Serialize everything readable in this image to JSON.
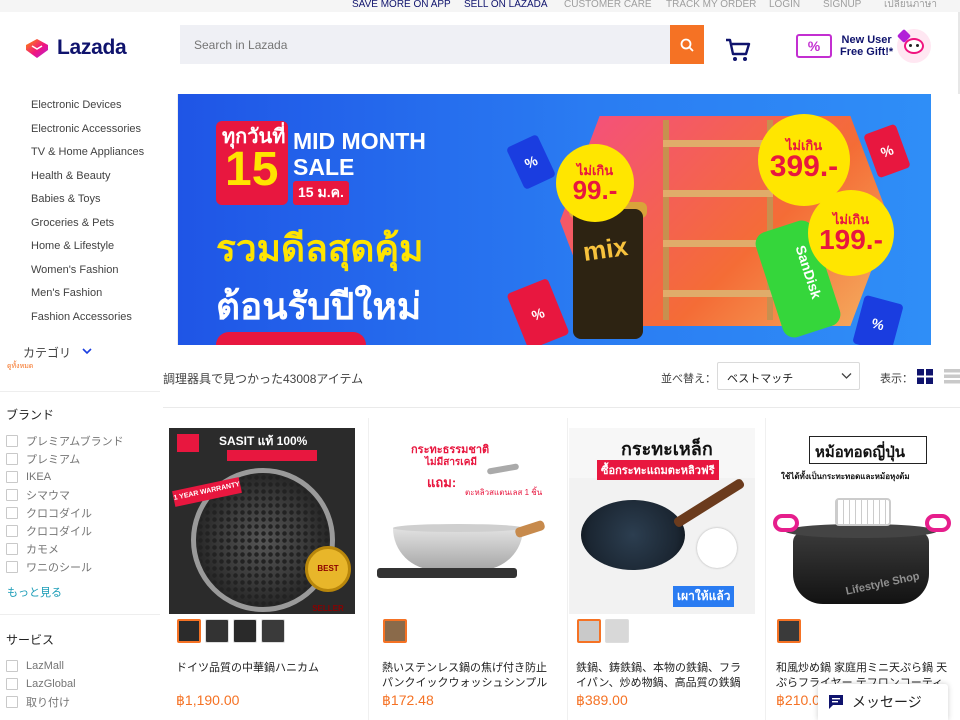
{
  "top_links": [
    "SAVE MORE ON APP",
    "SELL ON LAZADA",
    "CUSTOMER CARE",
    "TRACK MY ORDER",
    "LOGIN",
    "SIGNUP",
    "เปลี่ยนภาษา"
  ],
  "header": {
    "logo_text": "Lazada",
    "search_placeholder": "Search in Lazada",
    "promo_line1": "New User",
    "promo_line2": "Free Gift!*",
    "promo_ticket": "%"
  },
  "categories": [
    "Electronic Devices",
    "Electronic Accessories",
    "TV & Home Appliances",
    "Health & Beauty",
    "Babies & Toys",
    "Groceries & Pets",
    "Home & Lifestyle",
    "Women's Fashion",
    "Men's Fashion",
    "Fashion Accessories"
  ],
  "banner": {
    "thai_top": "ทุกวันที่",
    "day": "15",
    "headline1": "MID MONTH",
    "headline2": "SALE",
    "date": "15 ม.ค.",
    "thai_line1": "รวมดีลสุดคุ้ม",
    "thai_line2": "ต้อนรับปีใหม่",
    "prices": [
      {
        "top": "ไม่เกิน",
        "value": "99.-"
      },
      {
        "top": "ไม่เกิน",
        "value": "399.-"
      },
      {
        "top": "ไม่เกิน",
        "value": "199.-"
      }
    ],
    "product_text_1": "mix",
    "product_text_2": "SanDisk"
  },
  "category_dropdown": {
    "label": "カテゴリ",
    "sub": "ดูทั้งหมด"
  },
  "results": {
    "title": "調理器具で見つかった43008アイテム",
    "sort_label": "並べ替え：",
    "sort_value": "ベストマッチ",
    "view_label": "表示："
  },
  "filters": {
    "brand_heading": "ブランド",
    "brands": [
      "プレミアムブランド",
      "プレミアム",
      "IKEA",
      "シマウマ",
      "クロコダイル",
      "クロコダイル",
      "カモメ",
      "ワニのシール"
    ],
    "more_label": "もっと見る",
    "service_heading": "サービス",
    "services": [
      "LazMall",
      "LazGlobal",
      "取り付け"
    ]
  },
  "products": [
    {
      "title": "ドイツ品質の中華鍋ハニカム",
      "price": "฿1,190.00",
      "img_text_1": "SASIT แท้ 100%",
      "img_text_2": "1 YEAR WARRANTY",
      "img_text_3": "BEST SELLER",
      "thumb_count": 4
    },
    {
      "title": "熱いステンレス鍋の焦げ付き防止パンクイックウォッシュシンプルな揚...",
      "price": "฿172.48",
      "img_text_1": "กระทะธรรมชาติ",
      "img_text_2": "ไม่มีสารเคมี",
      "img_text_3": "แถม:",
      "img_text_4": "ตะหลิวสแตนเลส 1 ชิ้น",
      "thumb_count": 1
    },
    {
      "title": "鉄鍋、鋳鉄鍋、本物の鉄鍋、フライパン、炒め物鍋、高品質の鉄鍋 フ...",
      "price": "฿389.00",
      "img_text_1": "กระทะเหล็ก",
      "img_text_2": "ซื้อกระทะแถมตะหลิวฟรี",
      "img_text_3": "เผาให้แล้ว",
      "thumb_count": 2
    },
    {
      "title": "和風炒め鍋 家庭用ミニ天ぷら鍋 天ぷらフライヤー テフロンコーティン...",
      "price": "฿210.0",
      "img_text_1": "หม้อทอดญี่ปุ่น",
      "img_text_2": "ใช้ได้ทั้งเป็นกระทะทอดและหม้อหุงต้ม",
      "img_text_3": "Lifestyle Shop",
      "thumb_count": 1
    }
  ],
  "chat": {
    "label": "メッセージ"
  },
  "colors": {
    "accent": "#f57224",
    "brand_navy": "#0f136d",
    "link": "#1a9cb7",
    "banner_blue": "#1f55e6"
  }
}
